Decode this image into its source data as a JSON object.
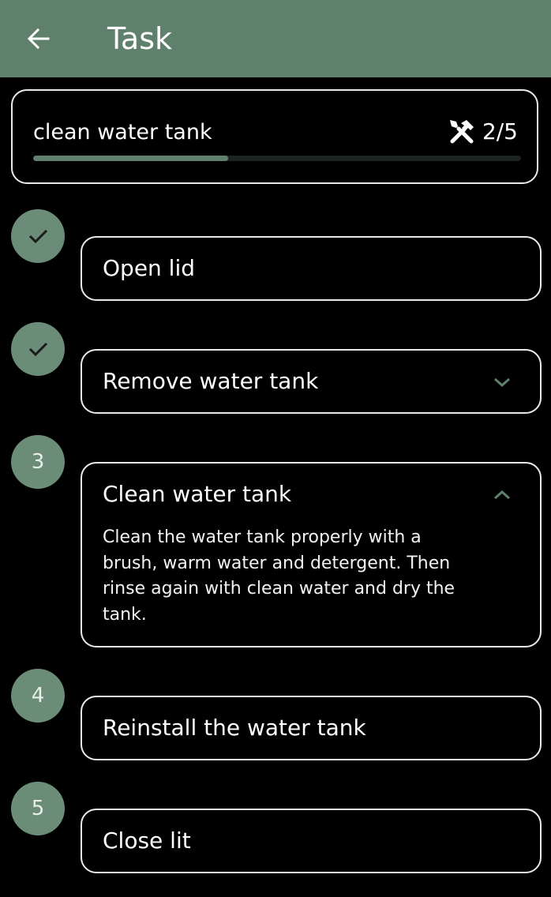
{
  "appbar": {
    "title": "Task",
    "back_icon": "arrow-left-icon",
    "background": "#5f806b"
  },
  "task": {
    "name": "clean water tank",
    "counter": "2/5",
    "icon": "tools-icon",
    "progress": 0.4
  },
  "steps": [
    {
      "marker": "",
      "status": "done",
      "title": "Open lid",
      "expandable": false
    },
    {
      "marker": "",
      "status": "done",
      "title": "Remove water tank",
      "expandable": true,
      "expanded": false
    },
    {
      "marker": "3",
      "status": "current",
      "title": "Clean water tank",
      "expandable": true,
      "expanded": true,
      "description": "Clean the water tank properly with a brush, warm water and detergent. Then rinse again with clean water and dry the tank."
    },
    {
      "marker": "4",
      "status": "pending",
      "title": "Reinstall the water tank",
      "expandable": false
    },
    {
      "marker": "5",
      "status": "pending",
      "title": "Close lit",
      "expandable": false
    }
  ],
  "colors": {
    "accent": "#5f806b",
    "step_circle": "#6b8c77",
    "card_border": "#e8ece9",
    "background": "#000000"
  }
}
